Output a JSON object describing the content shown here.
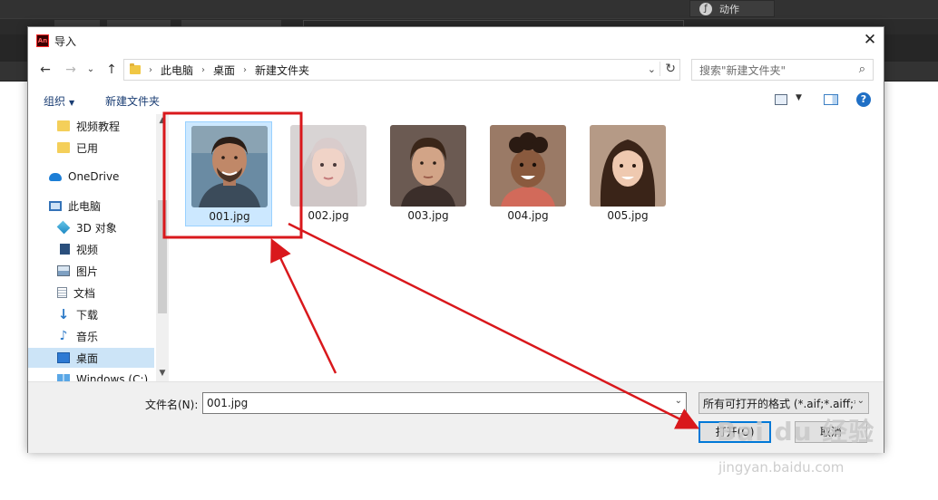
{
  "app": {
    "panel_label": "动作"
  },
  "dialog": {
    "title": "导入",
    "logo_text": "An",
    "close_glyph": "✕"
  },
  "nav": {
    "back": "←",
    "forward": "→",
    "dropdown": "⌄",
    "up": "↑",
    "breadcrumbs": [
      "此电脑",
      "桌面",
      "新建文件夹"
    ],
    "breadcrumb_sep": "›",
    "refresh": "↻",
    "search_placeholder": "搜索\"新建文件夹\"",
    "search_icon": "⌕"
  },
  "toolbar": {
    "organize_label": "组织",
    "new_folder_label": "新建文件夹",
    "help": "?"
  },
  "sidebar": {
    "items": [
      {
        "label": "视频教程",
        "icon": "folder-icon"
      },
      {
        "label": "已用",
        "icon": "folder-icon"
      },
      {
        "label": "OneDrive",
        "icon": "onedrive-icon"
      },
      {
        "label": "此电脑",
        "icon": "pc-icon"
      },
      {
        "label": "3D 对象",
        "icon": "3d-objects-icon"
      },
      {
        "label": "视频",
        "icon": "video-icon"
      },
      {
        "label": "图片",
        "icon": "pictures-icon"
      },
      {
        "label": "文档",
        "icon": "documents-icon"
      },
      {
        "label": "下载",
        "icon": "downloads-icon"
      },
      {
        "label": "音乐",
        "icon": "music-icon"
      },
      {
        "label": "桌面",
        "icon": "desktop-icon"
      },
      {
        "label": "Windows (C:)",
        "icon": "drive-icon"
      }
    ],
    "selected": "桌面"
  },
  "files": [
    {
      "name": "001.jpg",
      "selected": true
    },
    {
      "name": "002.jpg",
      "selected": false
    },
    {
      "name": "003.jpg",
      "selected": false
    },
    {
      "name": "004.jpg",
      "selected": false
    },
    {
      "name": "005.jpg",
      "selected": false
    }
  ],
  "bottom": {
    "filename_label": "文件名(N):",
    "filename_value": "001.jpg",
    "filetype_value": "所有可打开的格式 (*.aif;*.aiff;*",
    "open_label": "打开(O)",
    "cancel_label": "取消"
  },
  "watermark": {
    "text": "Bai du 经验",
    "sub": "jingyan.baidu.com"
  },
  "colors": {
    "accent": "#0078d7",
    "selection": "#cce8ff",
    "annotation": "#d9181c"
  }
}
